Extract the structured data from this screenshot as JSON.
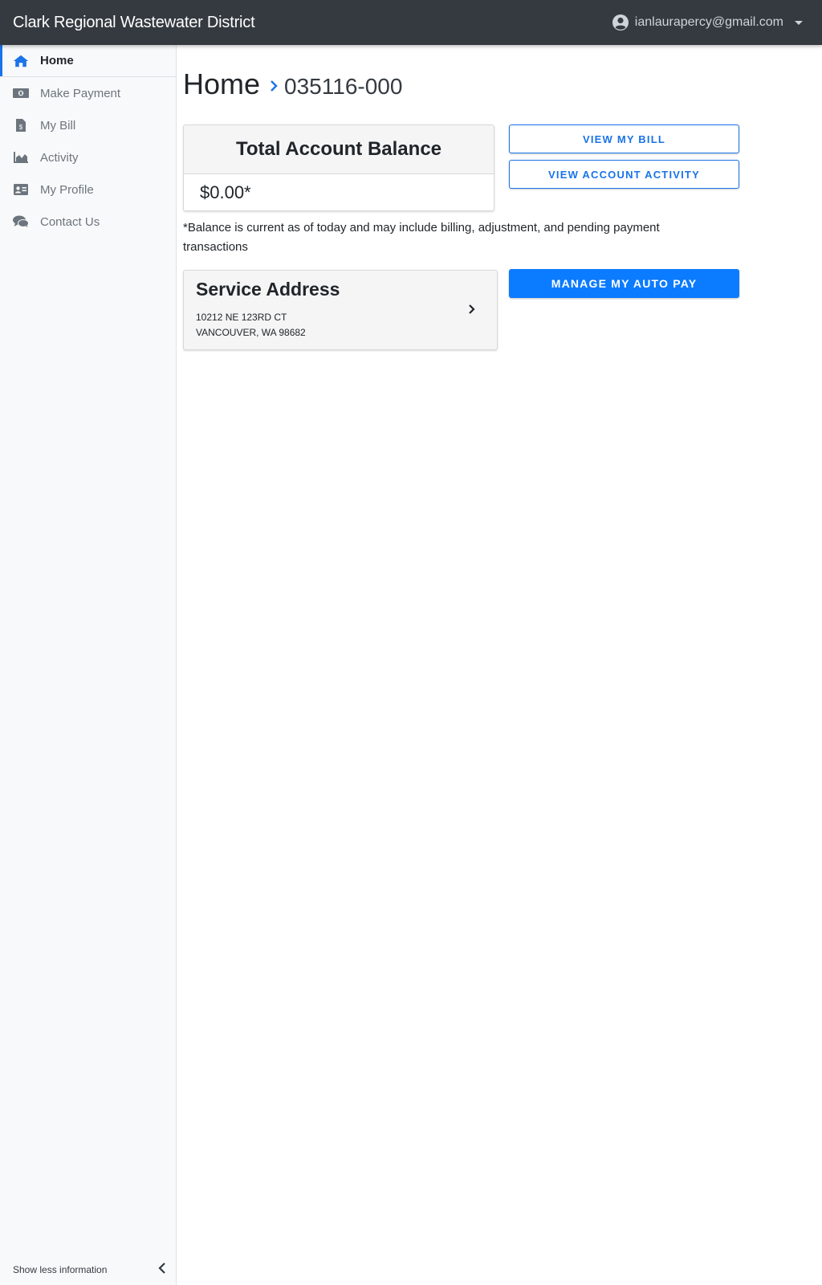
{
  "header": {
    "title": "Clark Regional Wastewater District",
    "user_email": "ianlaurapercy@gmail.com"
  },
  "sidebar": {
    "items": [
      {
        "label": "Home",
        "icon": "home-icon",
        "active": true
      },
      {
        "label": "Make Payment",
        "icon": "money-icon",
        "active": false
      },
      {
        "label": "My Bill",
        "icon": "bill-icon",
        "active": false
      },
      {
        "label": "Activity",
        "icon": "area-chart-icon",
        "active": false
      },
      {
        "label": "My Profile",
        "icon": "id-card-icon",
        "active": false
      },
      {
        "label": "Contact Us",
        "icon": "chat-icon",
        "active": false
      }
    ],
    "footer_label": "Show less information"
  },
  "breadcrumb": {
    "home": "Home",
    "account": "035116-000"
  },
  "balance_card": {
    "title": "Total Account Balance",
    "amount": "$0.00*"
  },
  "buttons": {
    "view_bill": "VIEW MY BILL",
    "view_activity": "VIEW ACCOUNT ACTIVITY",
    "auto_pay": "MANAGE MY AUTO PAY"
  },
  "balance_note": "*Balance is current as of today and may include billing, adjustment, and pending payment transactions",
  "service_address": {
    "title": "Service Address",
    "line1": "10212 NE 123RD CT",
    "line2": "VANCOUVER, WA 98682"
  },
  "colors": {
    "topbar": "#343a40",
    "accent": "#1a73e8",
    "primary_button": "#0b7bff"
  }
}
